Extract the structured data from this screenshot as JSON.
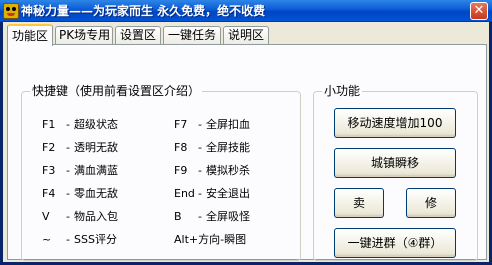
{
  "window": {
    "title": "神秘力量——为玩家而生   永久免费，绝不收费",
    "close_glyph": "✕"
  },
  "tabs": [
    {
      "label": "功能区",
      "active": true
    },
    {
      "label": "PK场专用",
      "active": false
    },
    {
      "label": "设置区",
      "active": false
    },
    {
      "label": "一键任务",
      "active": false
    },
    {
      "label": "说明区",
      "active": false
    }
  ],
  "hotkeys": {
    "title": "快捷键（使用前看设置区介绍）",
    "left": [
      {
        "key": "F1",
        "sep": "-",
        "desc": "超级状态"
      },
      {
        "key": "F2",
        "sep": "-",
        "desc": "透明无敌"
      },
      {
        "key": "F3",
        "sep": "-",
        "desc": "满血满蓝"
      },
      {
        "key": "F4",
        "sep": "-",
        "desc": "零血无敌"
      },
      {
        "key": "V",
        "sep": "-",
        "desc": "物品入包"
      },
      {
        "key": "~",
        "sep": "-",
        "desc": "SSS评分"
      }
    ],
    "right": [
      {
        "key": "F7",
        "sep": "-",
        "desc": "全屏扣血"
      },
      {
        "key": "F8",
        "sep": "-",
        "desc": "全屏技能"
      },
      {
        "key": "F9",
        "sep": "-",
        "desc": "模拟秒杀"
      },
      {
        "key": "End",
        "sep": "-",
        "desc": "安全退出"
      },
      {
        "key": "B",
        "sep": "-",
        "desc": "全屏吸怪"
      },
      {
        "key": "Alt+方向",
        "sep": "-",
        "desc": "瞬图"
      }
    ]
  },
  "functions": {
    "title": "小功能",
    "speed_button": "移动速度增加100",
    "teleport_button": "城镇瞬移",
    "sell_button": "卖",
    "repair_button": "修",
    "group_button": "一键进群（④群）"
  }
}
